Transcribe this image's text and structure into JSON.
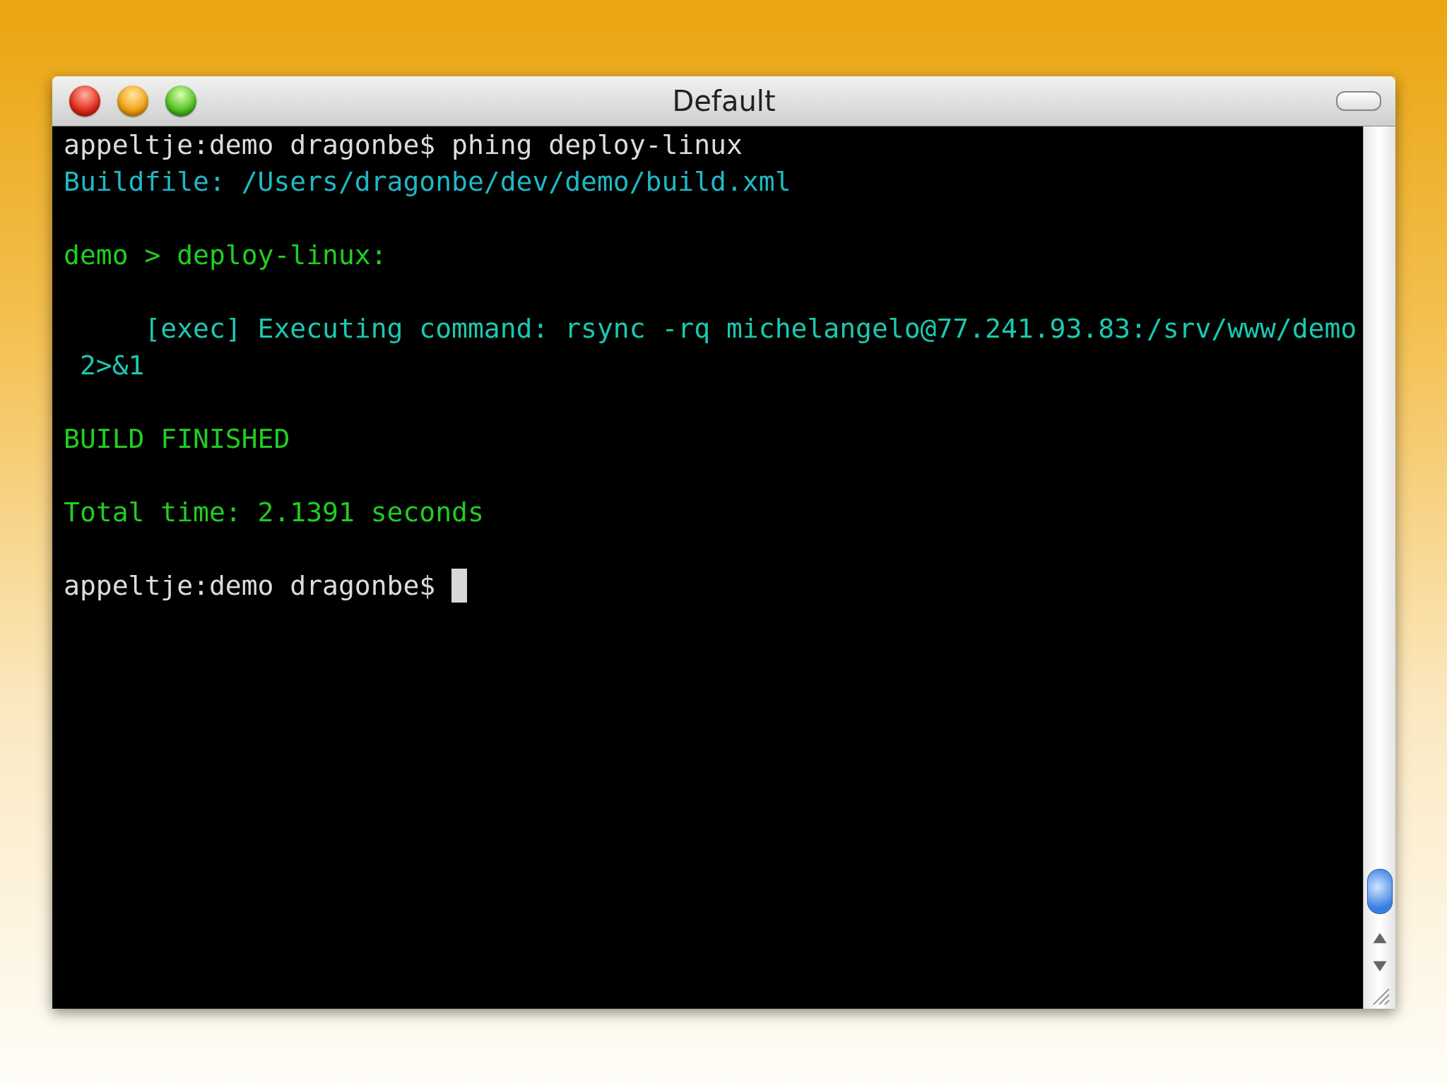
{
  "window": {
    "title": "Default"
  },
  "terminal": {
    "lines": [
      {
        "kind": "text",
        "text": "appeltje:demo dragonbe$ phing deploy-linux",
        "color": "#dcdcdc"
      },
      {
        "kind": "text",
        "text": "Buildfile: /Users/dragonbe/dev/demo/build.xml",
        "color": "#1fb8c4"
      },
      {
        "kind": "blank"
      },
      {
        "kind": "text",
        "text": "demo > deploy-linux:",
        "color": "#22cc22"
      },
      {
        "kind": "blank"
      },
      {
        "kind": "text",
        "text": "     [exec] Executing command: rsync -rq michelangelo@77.241.93.83:/srv/www/demo",
        "color": "#1cc8b0"
      },
      {
        "kind": "text",
        "text": " 2>&1",
        "color": "#1cc8b0"
      },
      {
        "kind": "blank"
      },
      {
        "kind": "text",
        "text": "BUILD FINISHED",
        "color": "#22cc22"
      },
      {
        "kind": "blank"
      },
      {
        "kind": "text",
        "text": "Total time: 2.1391 seconds",
        "color": "#22cc22"
      },
      {
        "kind": "blank"
      },
      {
        "kind": "prompt",
        "text": "appeltje:demo dragonbe$ ",
        "color": "#dcdcdc"
      }
    ]
  }
}
